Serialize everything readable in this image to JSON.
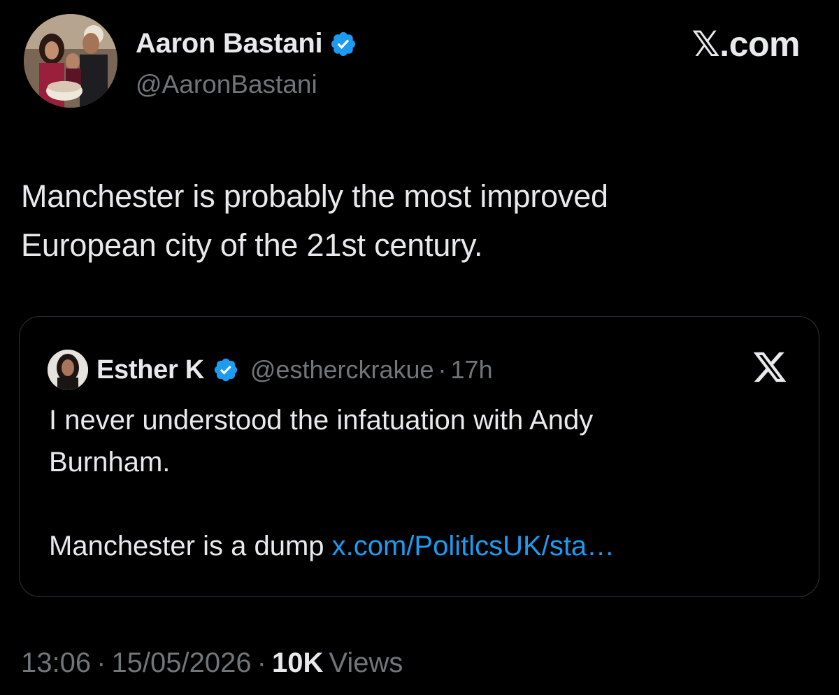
{
  "brand": {
    "label": "𝕏.com"
  },
  "author": {
    "name": "Aaron Bastani",
    "handle": "@AaronBastani",
    "verified_color": "#1d9bf0"
  },
  "tweet": {
    "text_lines": [
      "Manchester is probably the most improved",
      "European city of the 21st century."
    ]
  },
  "quoted": {
    "name": "Esther K",
    "handle": "@estherckrakue",
    "separator": "·",
    "time": "17h",
    "lines": [
      "I never understood the infatuation with Andy",
      "Burnham."
    ],
    "last_line_text": "Manchester is a dump ",
    "link": "x.com/PolitlcsUK/sta…",
    "link_color": "#1d9bf0",
    "platform_icon": "x-logo-icon"
  },
  "footer": {
    "time": "13:06",
    "separator": "·",
    "date": "15/05/2026",
    "views_count": "10K",
    "views_label": "Views"
  }
}
